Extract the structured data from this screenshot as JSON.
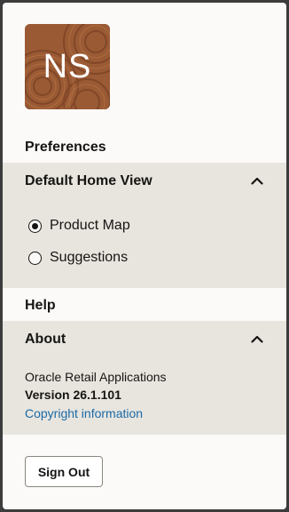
{
  "avatar": {
    "initials": "NS",
    "color": "#9a5a34"
  },
  "preferences": {
    "heading": "Preferences",
    "default_home_view": {
      "title": "Default Home View",
      "expanded": true,
      "options": [
        {
          "label": "Product Map",
          "selected": true
        },
        {
          "label": "Suggestions",
          "selected": false
        }
      ]
    }
  },
  "help": {
    "heading": "Help",
    "about": {
      "title": "About",
      "expanded": true,
      "product": "Oracle Retail Applications",
      "version": "Version 26.1.101",
      "copyright_link": "Copyright information"
    }
  },
  "actions": {
    "sign_out": "Sign Out"
  },
  "colors": {
    "section_bg": "#e8e5df",
    "link": "#1b6aa6",
    "panel_bg": "#fbfaf8"
  }
}
